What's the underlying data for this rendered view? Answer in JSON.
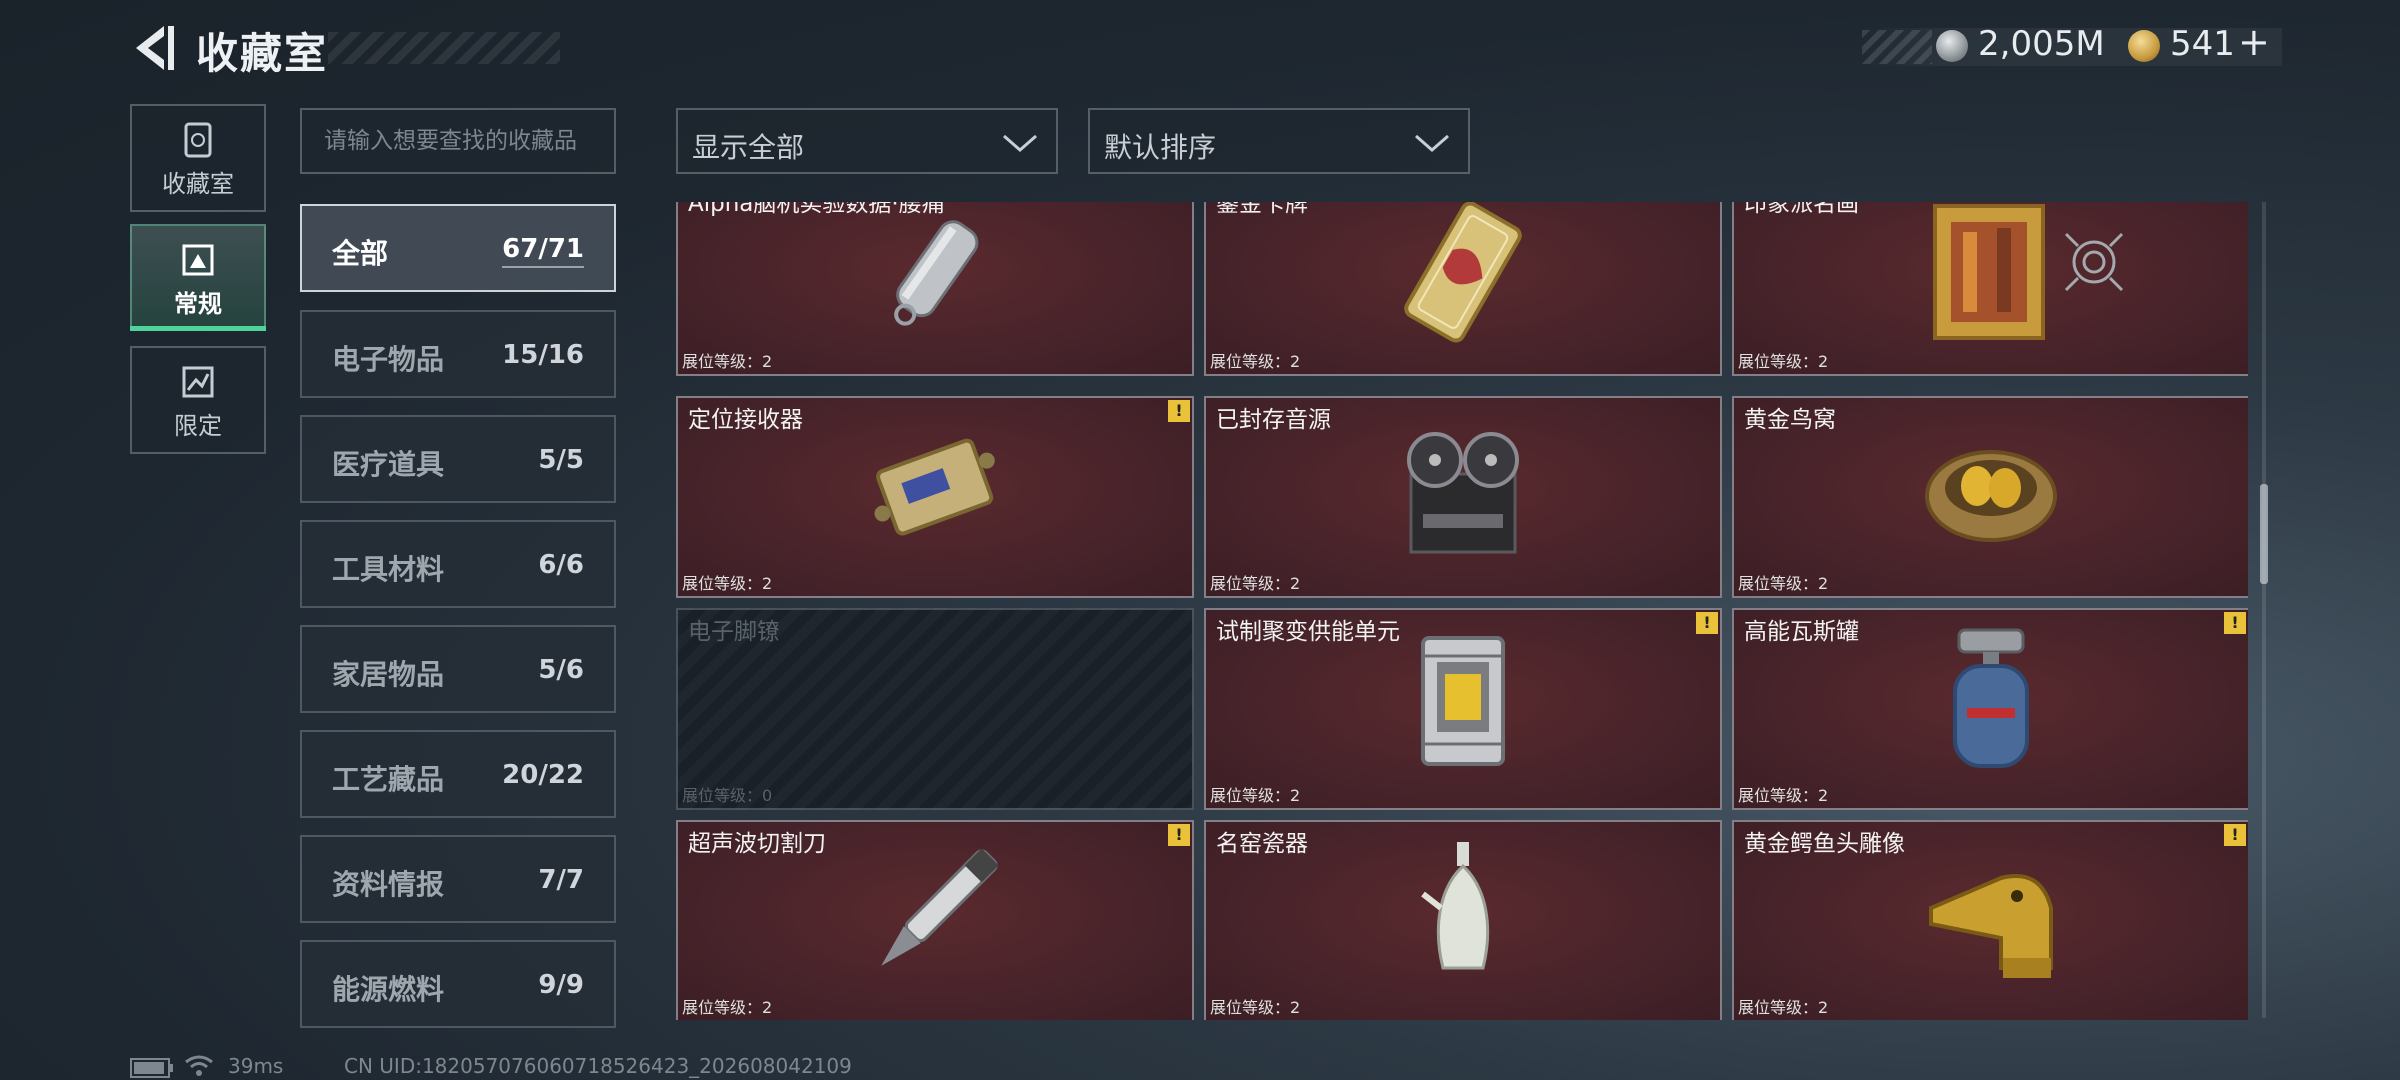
{
  "header": {
    "title": "收藏室"
  },
  "currency": {
    "silver": "2,005M",
    "gold": "541",
    "plus": "+"
  },
  "nav": [
    {
      "label": "收藏室",
      "active": false
    },
    {
      "label": "常规",
      "active": true
    },
    {
      "label": "限定",
      "active": false
    }
  ],
  "search": {
    "placeholder": "请输入想要查找的收藏品"
  },
  "categories": [
    {
      "name": "全部",
      "count": "67/71",
      "active": true
    },
    {
      "name": "电子物品",
      "count": "15/16"
    },
    {
      "name": "医疗道具",
      "count": "5/5"
    },
    {
      "name": "工具材料",
      "count": "6/6"
    },
    {
      "name": "家居物品",
      "count": "5/6"
    },
    {
      "name": "工艺藏品",
      "count": "20/22"
    },
    {
      "name": "资料情报",
      "count": "7/7"
    },
    {
      "name": "能源燃料",
      "count": "9/9"
    }
  ],
  "filters": {
    "show": "显示全部",
    "sort": "默认排序"
  },
  "items": [
    {
      "name": "Alpha脑机实验数据·腰痛",
      "level": "展位等级：2",
      "warn": false,
      "icon": "usb-drive"
    },
    {
      "name": "鎏金卡牌",
      "level": "展位等级：2",
      "warn": false,
      "icon": "gilded-card"
    },
    {
      "name": "印象派名画",
      "level": "展位等级：2",
      "warn": false,
      "icon": "painting"
    },
    {
      "name": "定位接收器",
      "level": "展位等级：2",
      "warn": true,
      "icon": "receiver"
    },
    {
      "name": "已封存音源",
      "level": "展位等级：2",
      "warn": false,
      "icon": "tape-recorder"
    },
    {
      "name": "黄金鸟窝",
      "level": "展位等级：2",
      "warn": false,
      "icon": "golden-nest"
    },
    {
      "name": "电子脚镣",
      "level": "展位等级：0",
      "warn": false,
      "locked": true,
      "icon": "ankle-monitor"
    },
    {
      "name": "试制聚变供能单元",
      "level": "展位等级：2",
      "warn": true,
      "icon": "fusion-unit"
    },
    {
      "name": "高能瓦斯罐",
      "level": "展位等级：2",
      "warn": true,
      "icon": "gas-tank"
    },
    {
      "name": "超声波切割刀",
      "level": "展位等级：2",
      "warn": true,
      "icon": "cutter"
    },
    {
      "name": "名窑瓷器",
      "level": "展位等级：2",
      "warn": false,
      "icon": "porcelain-vase"
    },
    {
      "name": "黄金鳄鱼头雕像",
      "level": "展位等级：2",
      "warn": true,
      "icon": "gold-crocodile"
    }
  ],
  "footer": {
    "ping": "39ms",
    "uid": "CN UID:182057076060718526423_202608042109"
  },
  "colors": {
    "accent": "#4fd39c",
    "card_bg": "#47232a",
    "warning": "#e9c23a"
  }
}
